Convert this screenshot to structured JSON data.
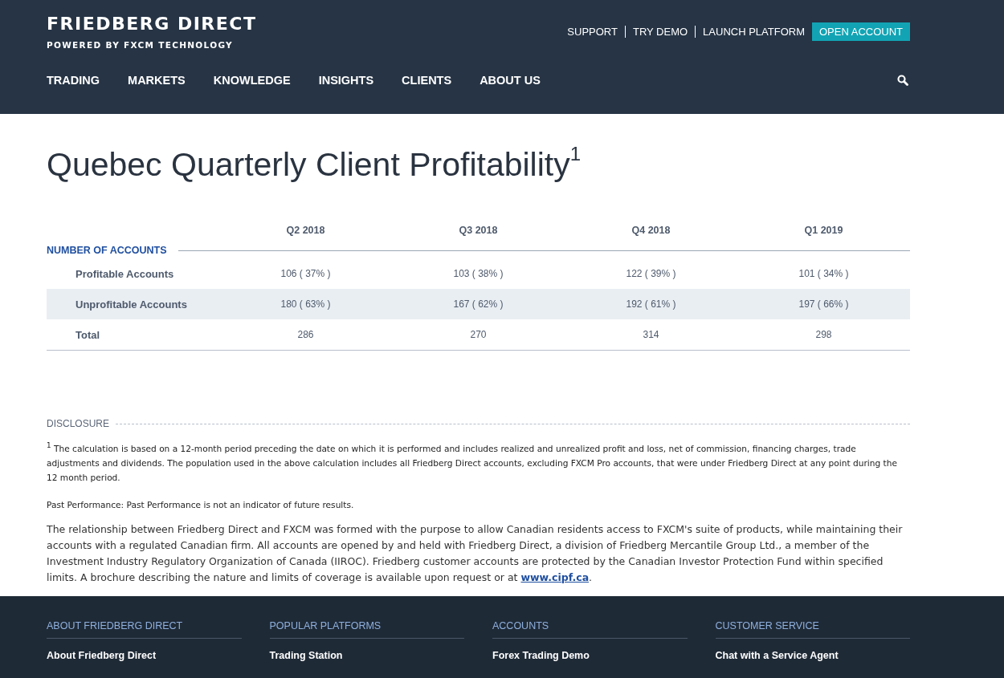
{
  "brand": {
    "name": "FRIEDBERG DIRECT",
    "tagline": "POWERED BY FXCM TECHNOLOGY"
  },
  "top_links": [
    "SUPPORT",
    "TRY DEMO",
    "LAUNCH PLATFORM"
  ],
  "open_account": "OPEN ACCOUNT",
  "nav": [
    "TRADING",
    "MARKETS",
    "KNOWLEDGE",
    "INSIGHTS",
    "CLIENTS",
    "ABOUT US"
  ],
  "title": "Quebec Quarterly Client Profitability$^{1}$",
  "table": {
    "section": "NUMBER OF ACCOUNTS",
    "columns": [
      "Q2 2018",
      "Q3 2018",
      "Q4 2018",
      "Q1 2019"
    ],
    "rows": [
      {
        "label": "Profitable Accounts",
        "cells": [
          "106 ( 37% )",
          "103 ( 38% )",
          "122 ( 39% )",
          "101 ( 34% )"
        ]
      },
      {
        "label": "Unprofitable Accounts",
        "cells": [
          "180 ( 63% )",
          "167 ( 62% )",
          "192 ( 61% )",
          "197 ( 66% )"
        ]
      },
      {
        "label": "Total",
        "cells": [
          "286",
          "270",
          "314",
          "298"
        ]
      }
    ]
  },
  "disclosure": {
    "heading": "DISCLOSURE",
    "paragraphs": [
      "$^{1}$ The calculation is based on a 12-month period preceding the date on which it is performed and includes realized and unrealized profit and loss, net of commission, financing charges, trade adjustments and dividends. The population used in the above calculation includes all Friedberg Direct accounts, excluding FXCM Pro accounts, that were under Friedberg Direct at any point during the 12 month period.",
      "Past Performance: Past Performance is not an indicator of future results."
    ]
  },
  "relationship": {
    "text": "The relationship between Friedberg Direct and FXCM was formed with the purpose to allow Canadian residents access to FXCM's suite of products, while maintaining their accounts with a regulated Canadian firm. All accounts are opened by and held with Friedberg Direct, a division of Friedberg Mercantile Group Ltd., a member of the Investment Industry Regulatory Organization of Canada (IIROC). Friedberg customer accounts are protected by the Canadian Investor Protection Fund within specified limits. A brochure describing the nature and limits of coverage is available upon request or at ",
    "link": "www.cipf.ca",
    "tail": "."
  },
  "footer": [
    {
      "heading": "ABOUT FRIEDBERG DIRECT",
      "links": [
        "About Friedberg Direct"
      ]
    },
    {
      "heading": "POPULAR PLATFORMS",
      "links": [
        "Trading Station"
      ]
    },
    {
      "heading": "ACCOUNTS",
      "links": [
        "Forex Trading Demo"
      ]
    },
    {
      "heading": "CUSTOMER SERVICE",
      "links": [
        "Chat with a Service Agent"
      ]
    }
  ]
}
